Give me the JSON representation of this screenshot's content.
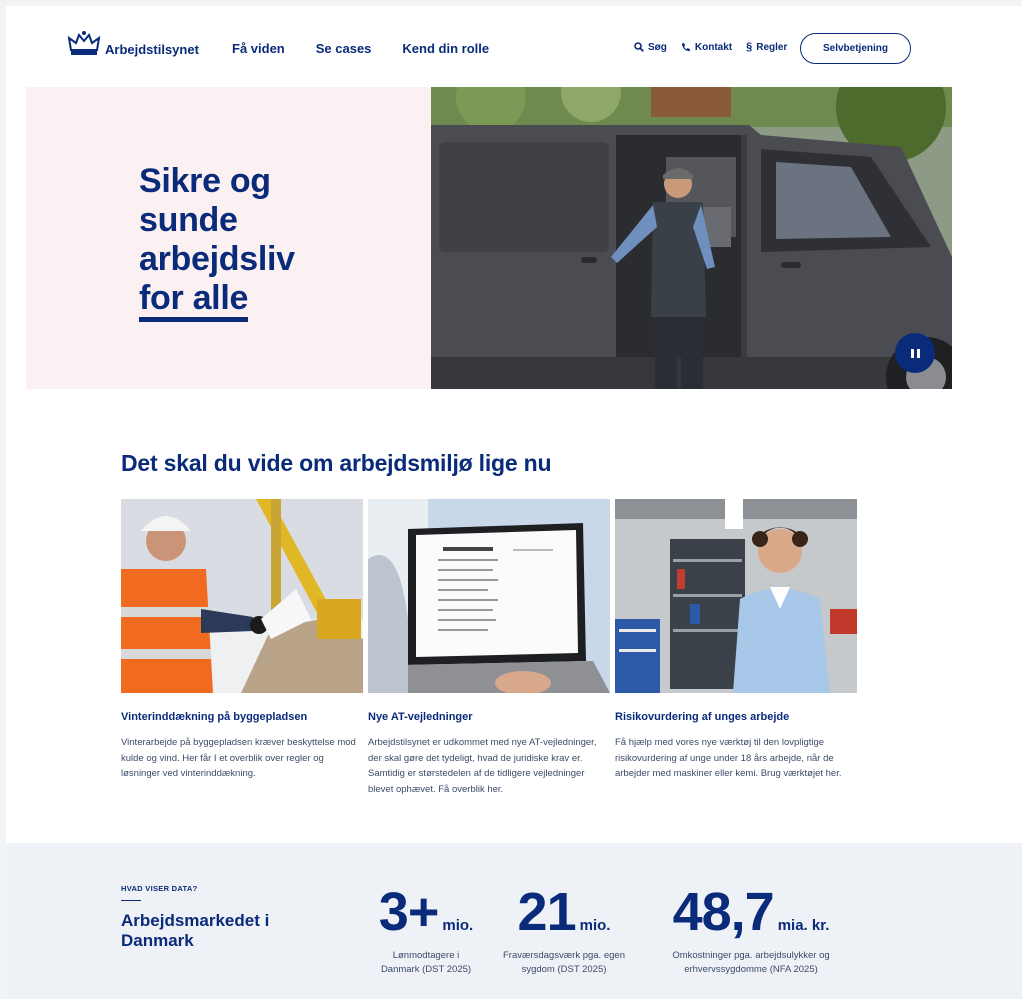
{
  "header": {
    "logo_text": "Arbejdstilsynet",
    "nav": [
      "Få viden",
      "Se cases",
      "Kend din rolle"
    ],
    "utility": {
      "search": "Søg",
      "contact": "Kontakt",
      "rules": "Regler"
    },
    "self_service": "Selvbetjening"
  },
  "hero": {
    "title_lines": [
      "Sikre og",
      "sunde",
      "arbejdsliv"
    ],
    "title_underlined": "for alle"
  },
  "news": {
    "title": "Det skal du vide om arbejdsmiljø lige nu",
    "cards": [
      {
        "title": "Vinterinddækning på byggepladsen",
        "text": "Vinterarbejde på byggepladsen kræver beskyttelse mod kulde og vind. Her får I et overblik over regler og løsninger ved vinterinddækning."
      },
      {
        "title": "Nye AT-vejledninger",
        "text": "Arbejdstilsynet er udkommet med nye AT-vejledninger, der skal gøre det tydeligt, hvad de juridiske krav er. Samtidig er størstedelen af de tidligere vejledninger blevet ophævet. Få overblik her."
      },
      {
        "title": "Risikovurdering af unges arbejde",
        "text": "Få hjælp med vores nye værktøj til den lovpligtige risikovurdering af unge under 18 års arbejde, når de arbejder med maskiner eller kemi. Brug værktøjet her."
      }
    ]
  },
  "stats": {
    "eyebrow": "HVAD VISER DATA?",
    "title_lines": [
      "Arbejdsmarkedet i",
      "Danmark"
    ],
    "items": [
      {
        "value": "3+",
        "unit": "mio.",
        "caption_lines": [
          "Lønmodtagere i",
          "Danmark (DST 2025)"
        ]
      },
      {
        "value": "21",
        "unit": "mio.",
        "caption_lines": [
          "Fraværsdagsværk pga. egen",
          "sygdom (DST 2025)"
        ]
      },
      {
        "value": "48,7",
        "unit": "mia. kr.",
        "caption_lines": [
          "Omkostninger pga. arbejdsulykker og",
          "erhvervssygdomme (NFA 2025)"
        ]
      }
    ]
  },
  "colors": {
    "brand_navy": "#0a2a7a",
    "hero_pink": "#fcf1f2",
    "stats_bg": "#eef2f7"
  }
}
